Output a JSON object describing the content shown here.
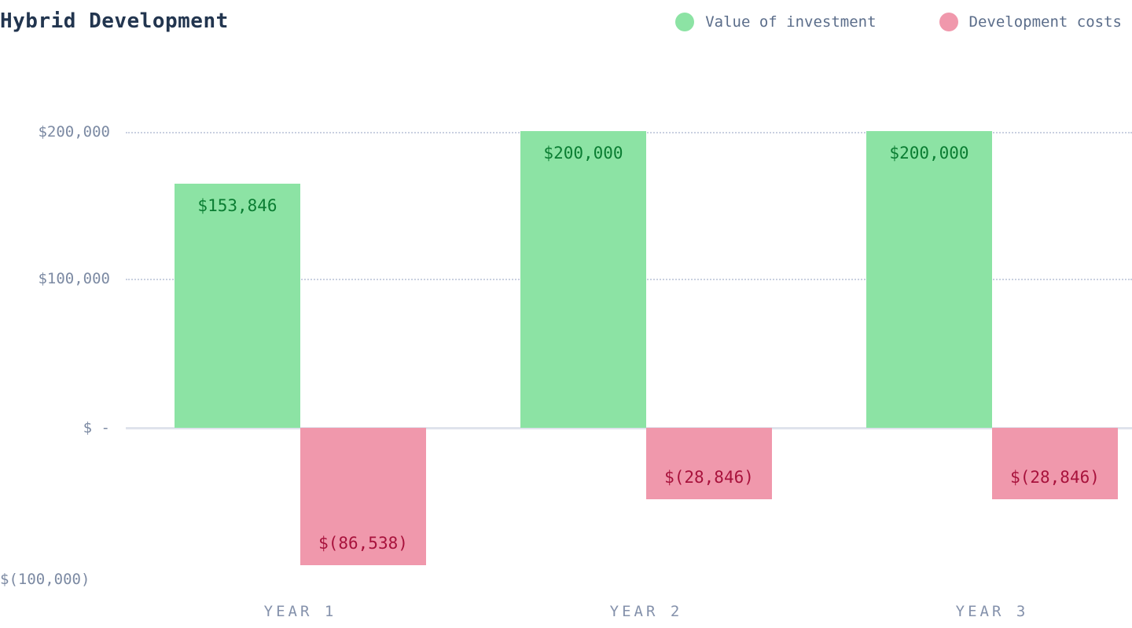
{
  "header": {
    "title": "Hybrid Development"
  },
  "legend": {
    "items": [
      {
        "label": "Value of investment",
        "color": "#8ce3a4",
        "name": "legend-value-of-investment"
      },
      {
        "label": "Development costs",
        "color": "#f098ac",
        "name": "legend-development-costs"
      }
    ]
  },
  "axis": {
    "y_ticks": [
      {
        "label": "$200,000",
        "value": 200000
      },
      {
        "label": "$100,000",
        "value": 100000
      },
      {
        "label": "$ -",
        "value": 0
      },
      {
        "label": "$(100,000)",
        "value": -100000
      }
    ],
    "x_ticks": [
      "YEAR 1",
      "YEAR 2",
      "YEAR 3"
    ]
  },
  "chart_data": {
    "type": "bar",
    "title": "Hybrid Development",
    "xlabel": "",
    "ylabel": "",
    "ylim": [
      -100000,
      200000
    ],
    "grid": true,
    "legend_position": "top-right",
    "categories": [
      "YEAR 1",
      "YEAR 2",
      "YEAR 3"
    ],
    "series": [
      {
        "name": "Value of investment",
        "color": "#8ce3a4",
        "label_color": "#0a7d32",
        "values": [
          153846,
          200000,
          200000
        ],
        "labels": [
          "$153,846",
          "$200,000",
          "$200,000"
        ]
      },
      {
        "name": "Development costs",
        "color": "#f098ac",
        "label_color": "#a8123c",
        "values": [
          -86538,
          -28846,
          -28846
        ],
        "labels": [
          "$(86,538)",
          "$(28,846)",
          "$(28,846)"
        ]
      }
    ]
  },
  "colors": {
    "title": "#22354f",
    "axis_text": "#7c8aa3",
    "gridline": "#c9d0e0",
    "zeroline": "#dfe3ec",
    "background": "#ffffff"
  }
}
